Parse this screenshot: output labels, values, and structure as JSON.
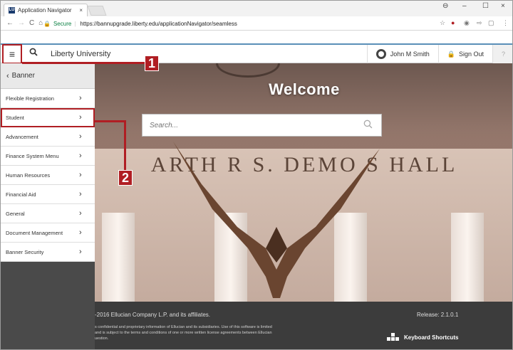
{
  "browser": {
    "tab_title": "Application Navigator",
    "tab_close": "×",
    "favicon": "LU",
    "secure_label": "Secure",
    "url": "https://bannupgrade.liberty.edu/applicationNavigator/seamless",
    "controls": {
      "profile": "⊖",
      "minimize": "–",
      "maximize": "☐",
      "close": "×"
    }
  },
  "header": {
    "brand": "Liberty University",
    "user_name": "John M Smith",
    "signout_label": "Sign Out",
    "help_label": "?"
  },
  "sidebar": {
    "back_label": "Banner",
    "items": [
      {
        "label": "Flexible Registration"
      },
      {
        "label": "Student"
      },
      {
        "label": "Advancement"
      },
      {
        "label": "Finance System Menu"
      },
      {
        "label": "Human Resources"
      },
      {
        "label": "Financial Aid"
      },
      {
        "label": "General"
      },
      {
        "label": "Document Management"
      },
      {
        "label": "Banner Security"
      }
    ]
  },
  "main": {
    "welcome": "Welcome",
    "search_placeholder": "Search...",
    "inscription": "ARTH R S. DEMO S HALL"
  },
  "footer": {
    "copyright": "-2016 Ellucian Company L.P. and its affiliates.",
    "release": "Release: 2.1.0.1",
    "legal_1": "s confidential and proprietary information of Ellucian and its subsidiaries. Use of this software is limited",
    "legal_2": "and is subject to the terms and conditions of one or more written license agreements between Ellucian",
    "legal_3": "uestion.",
    "keyboard_shortcuts": "Keyboard Shortcuts"
  },
  "callouts": {
    "one": "1",
    "two": "2"
  },
  "colors": {
    "accent": "#b01e23",
    "header_border": "#5a8fb8",
    "footer": "#3c3c3c",
    "sidebar_bg": "#4a4a4a"
  }
}
